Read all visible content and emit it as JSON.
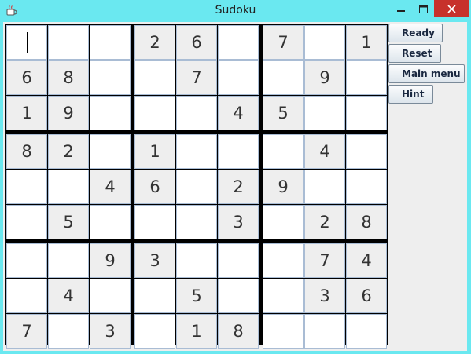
{
  "window": {
    "title": "Sudoku",
    "icon": "java-coffee-cup-icon",
    "controls": [
      "minimize-icon",
      "maximize-icon",
      "close-icon"
    ],
    "title_bar_color": "#6ae8f0",
    "close_color": "#c7312b"
  },
  "board": {
    "rows": [
      [
        "",
        "",
        "",
        "2",
        "6",
        "",
        "7",
        "",
        "1"
      ],
      [
        "6",
        "8",
        "",
        "",
        "7",
        "",
        "",
        "9",
        ""
      ],
      [
        "1",
        "9",
        "",
        "",
        "",
        "4",
        "5",
        "",
        ""
      ],
      [
        "8",
        "2",
        "",
        "1",
        "",
        "",
        "",
        "4",
        ""
      ],
      [
        "",
        "",
        "4",
        "6",
        "",
        "2",
        "9",
        "",
        ""
      ],
      [
        "",
        "5",
        "",
        "",
        "",
        "3",
        "",
        "2",
        "8"
      ],
      [
        "",
        "",
        "9",
        "3",
        "",
        "",
        "",
        "7",
        "4"
      ],
      [
        "",
        "4",
        "",
        "",
        "5",
        "",
        "",
        "3",
        "6"
      ],
      [
        "7",
        "",
        "3",
        "",
        "1",
        "8",
        "",
        "",
        ""
      ]
    ],
    "given": [
      [
        0,
        0,
        0,
        1,
        1,
        0,
        1,
        0,
        1
      ],
      [
        1,
        1,
        0,
        0,
        1,
        0,
        0,
        1,
        0
      ],
      [
        1,
        1,
        0,
        0,
        0,
        1,
        1,
        0,
        0
      ],
      [
        1,
        1,
        0,
        1,
        0,
        0,
        0,
        1,
        0
      ],
      [
        0,
        0,
        1,
        1,
        0,
        1,
        1,
        0,
        0
      ],
      [
        0,
        1,
        0,
        0,
        0,
        1,
        0,
        1,
        1
      ],
      [
        0,
        0,
        1,
        1,
        0,
        0,
        0,
        1,
        1
      ],
      [
        0,
        1,
        0,
        0,
        1,
        0,
        0,
        1,
        1
      ],
      [
        1,
        0,
        1,
        0,
        1,
        1,
        0,
        0,
        0
      ]
    ],
    "focused_cell": [
      0,
      0
    ],
    "given_cell_color": "#eeeeee",
    "empty_cell_color": "#ffffff",
    "cell_border_color": "#a9bcd4",
    "block_border_color": "#000000"
  },
  "buttons": {
    "ready": "Ready",
    "reset": "Reset",
    "main_menu": "Main menu",
    "hint": "Hint"
  }
}
